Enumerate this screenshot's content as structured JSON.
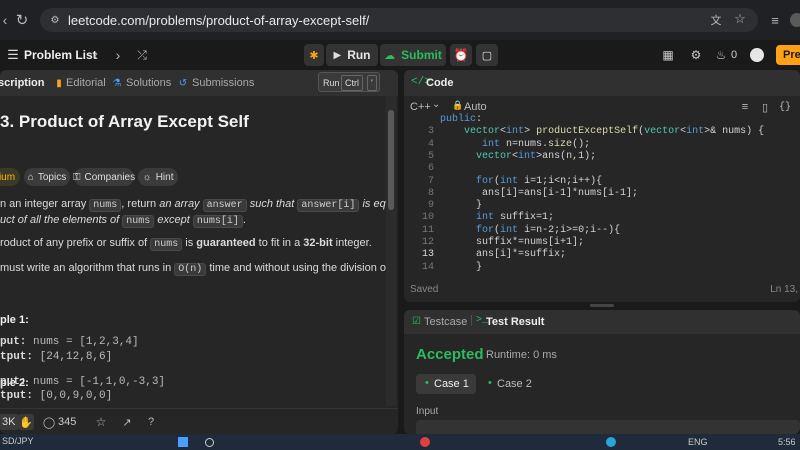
{
  "browser": {
    "url": "leetcode.com/problems/product-of-array-except-self/"
  },
  "header": {
    "problem_list": "Problem List",
    "run": "Run",
    "submit": "Submit",
    "count": "0",
    "premium": "Pre"
  },
  "left": {
    "tabs": [
      "scription",
      "Editorial",
      "Solutions",
      "Submissions"
    ],
    "shortcut": {
      "label": "Run",
      "key": "Ctrl",
      "extra": "'"
    },
    "title": "3. Product of Array Except Self",
    "tags": [
      "ium",
      "Topics",
      "Companies",
      "Hint"
    ],
    "desc1": {
      "a": "n an integer array ",
      "c1": "nums",
      "b": ", return ",
      "em1": "an array ",
      "c2": "answer",
      "em2": " such that ",
      "c3": "answer[i]",
      "em3": " is equal to the"
    },
    "desc2": {
      "em1": "uct of all the elements of ",
      "c1": "nums",
      "em2": " except ",
      "c2": "nums[i]",
      "end": "."
    },
    "desc3": {
      "a": "roduct of any prefix or suffix of ",
      "c1": "nums",
      "b": " is ",
      "strong1": "guaranteed",
      "c": " to fit in a ",
      "strong2": "32-bit",
      "d": " integer."
    },
    "desc4": {
      "a": "must write an algorithm that runs in ",
      "c1": "O(n)",
      "b": " time and without using the division operation."
    },
    "example1": {
      "title": "ple 1:",
      "input_label": "put:",
      "input": " nums = [1,2,3,4]",
      "output_label": "tput:",
      "output": " [24,12,8,6]"
    },
    "example2": {
      "title": "ple 2:",
      "input_label": "put:",
      "input": " nums = [-1,1,0,-3,3]",
      "output_label": "tput:",
      "output": " [0,0,9,0,0]"
    },
    "footer": {
      "likes": "3K",
      "comments": "345"
    }
  },
  "code": {
    "title": "Code",
    "language": "C++",
    "mode": "Auto",
    "lines": [
      {
        "n": "",
        "t": "public:"
      },
      {
        "n": "3",
        "t": "    vector<int> productExceptSelf(vector<int>& nums) {"
      },
      {
        "n": "4",
        "t": "       int n=nums.size();"
      },
      {
        "n": "5",
        "t": "      vector<int>ans(n,1);"
      },
      {
        "n": "6",
        "t": ""
      },
      {
        "n": "7",
        "t": "      for(int i=1;i<n;i++){"
      },
      {
        "n": "8",
        "t": "       ans[i]=ans[i-1]*nums[i-1];"
      },
      {
        "n": "9",
        "t": "      }"
      },
      {
        "n": "10",
        "t": "      int suffix=1;"
      },
      {
        "n": "11",
        "t": "      for(int i=n-2;i>=0;i--){"
      },
      {
        "n": "12",
        "t": "      suffix*=nums[i+1];"
      },
      {
        "n": "13",
        "t": "      ans[i]*=suffix;"
      },
      {
        "n": "14",
        "t": "      }"
      }
    ],
    "saved": "Saved",
    "position": "Ln 13,"
  },
  "result": {
    "tabs": [
      "Testcase",
      "Test Result"
    ],
    "status": "Accepted",
    "runtime": "Runtime: 0 ms",
    "cases": [
      "Case 1",
      "Case 2"
    ],
    "input_label": "Input"
  },
  "taskbar": {
    "left": "SD/JPY",
    "lang": "ENG",
    "time": "5:56"
  },
  "colors": {
    "accepted": "#2cbb5d",
    "submit": "#2cbb5d",
    "premium": "#ffa116",
    "background": "#1a1a1a"
  }
}
